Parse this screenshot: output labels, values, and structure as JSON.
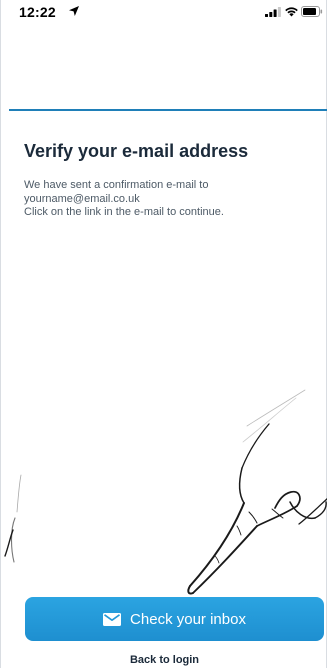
{
  "status_bar": {
    "time": "12:22",
    "icons": [
      "location-arrow-icon",
      "signal-icon",
      "wifi-icon",
      "battery-icon"
    ]
  },
  "page": {
    "title": "Verify your e-mail address",
    "message_lines": [
      "We have sent a confirmation e-mail to",
      "yourname@email.co.uk",
      "Click on the link in the e-mail to continue."
    ]
  },
  "actions": {
    "primary_label": "Check your inbox",
    "primary_icon": "mail-icon",
    "secondary_label": "Back to login"
  },
  "colors": {
    "accent": "#1f7fb8",
    "button": "#2399d9",
    "title": "#1b2a3a",
    "body_text": "#4d5a66"
  },
  "illustration": "hand-pointing-illustration"
}
